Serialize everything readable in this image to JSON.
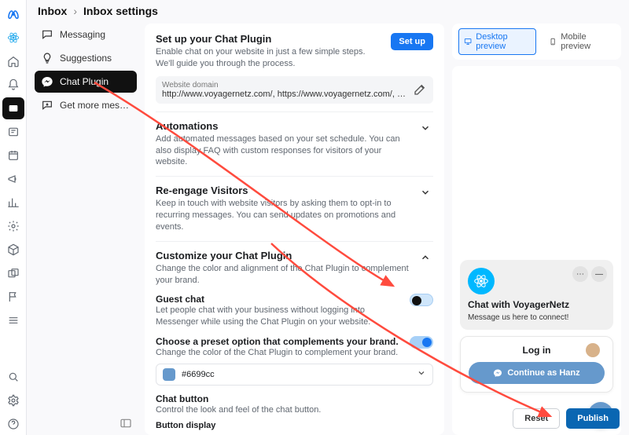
{
  "breadcrumb": {
    "root": "Inbox",
    "current": "Inbox settings"
  },
  "sidebar": {
    "items": [
      {
        "label": "Messaging",
        "icon": "chat-bubble-icon"
      },
      {
        "label": "Suggestions",
        "icon": "lightbulb-icon"
      },
      {
        "label": "Chat Plugin",
        "icon": "messenger-icon"
      },
      {
        "label": "Get more mess…",
        "icon": "download-icon"
      }
    ]
  },
  "settings": {
    "setup": {
      "title": "Set up your Chat Plugin",
      "desc": "Enable chat on your website in just a few simple steps. We'll guide you through the process.",
      "button": "Set up",
      "domain_label": "Website domain",
      "domain_value": "http://www.voyagernetz.com/, https://www.voyagernetz.com/, https://voyagerne…"
    },
    "automations": {
      "title": "Automations",
      "desc": "Add automated messages based on your set schedule. You can also display FAQ with custom responses for visitors of your website."
    },
    "reengage": {
      "title": "Re-engage Visitors",
      "desc": "Keep in touch with website visitors by asking them to opt-in to recurring messages. You can send updates on promotions and events."
    },
    "customize": {
      "title": "Customize your Chat Plugin",
      "desc": "Change the color and alignment of the Chat Plugin to complement your brand.",
      "guest_title": "Guest chat",
      "guest_desc": "Let people chat with your business without logging into Messenger while using the Chat Plugin on your website.",
      "preset_title": "Choose a preset option that complements your brand.",
      "preset_desc": "Change the color of the Chat Plugin to complement your brand.",
      "color_hex": "#6699cc",
      "chat_button_title": "Chat button",
      "chat_button_desc": "Control the look and feel of the chat button.",
      "button_display_label": "Button display"
    }
  },
  "preview": {
    "tabs": {
      "desktop": "Desktop preview",
      "mobile": "Mobile preview"
    },
    "widget_title": "Chat with VoyagerNetz",
    "widget_message": "Message us here to connect!",
    "login_label": "Log in",
    "continue_label": "Continue as Hanz"
  },
  "footer": {
    "reset": "Reset",
    "publish": "Publish"
  },
  "colors": {
    "accent": "#1877f2",
    "brand": "#6699cc"
  }
}
